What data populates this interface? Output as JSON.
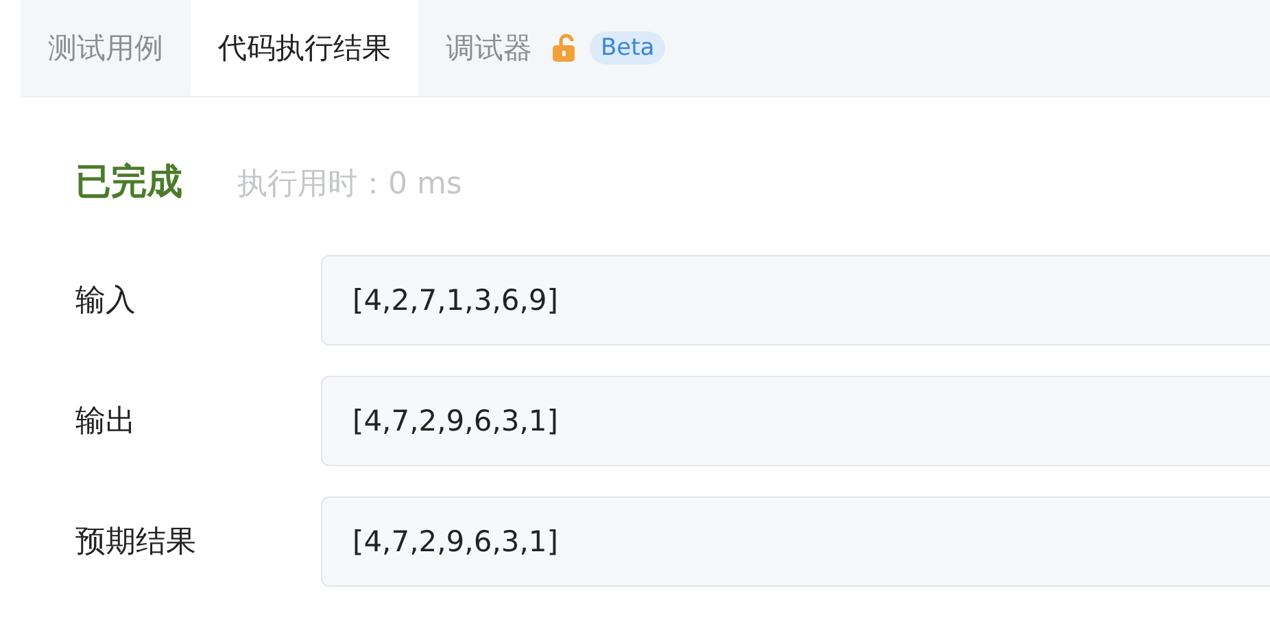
{
  "tabs": [
    {
      "label": "测试用例",
      "selected": false,
      "kind": "plain"
    },
    {
      "label": "代码执行结果",
      "selected": true,
      "kind": "plain"
    },
    {
      "label": "调试器",
      "selected": false,
      "kind": "locked",
      "badge": "Beta"
    }
  ],
  "result": {
    "status": "已完成",
    "kind": "success",
    "runtime": "执行用时：0 ms"
  },
  "rows": [
    {
      "label": "输入",
      "value": "[4,2,7,1,3,6,9]"
    },
    {
      "label": "输出",
      "value": "[4,7,2,9,6,3,1]"
    },
    {
      "label": "预期结果",
      "value": "[4,7,2,9,6,3,1]"
    }
  ]
}
